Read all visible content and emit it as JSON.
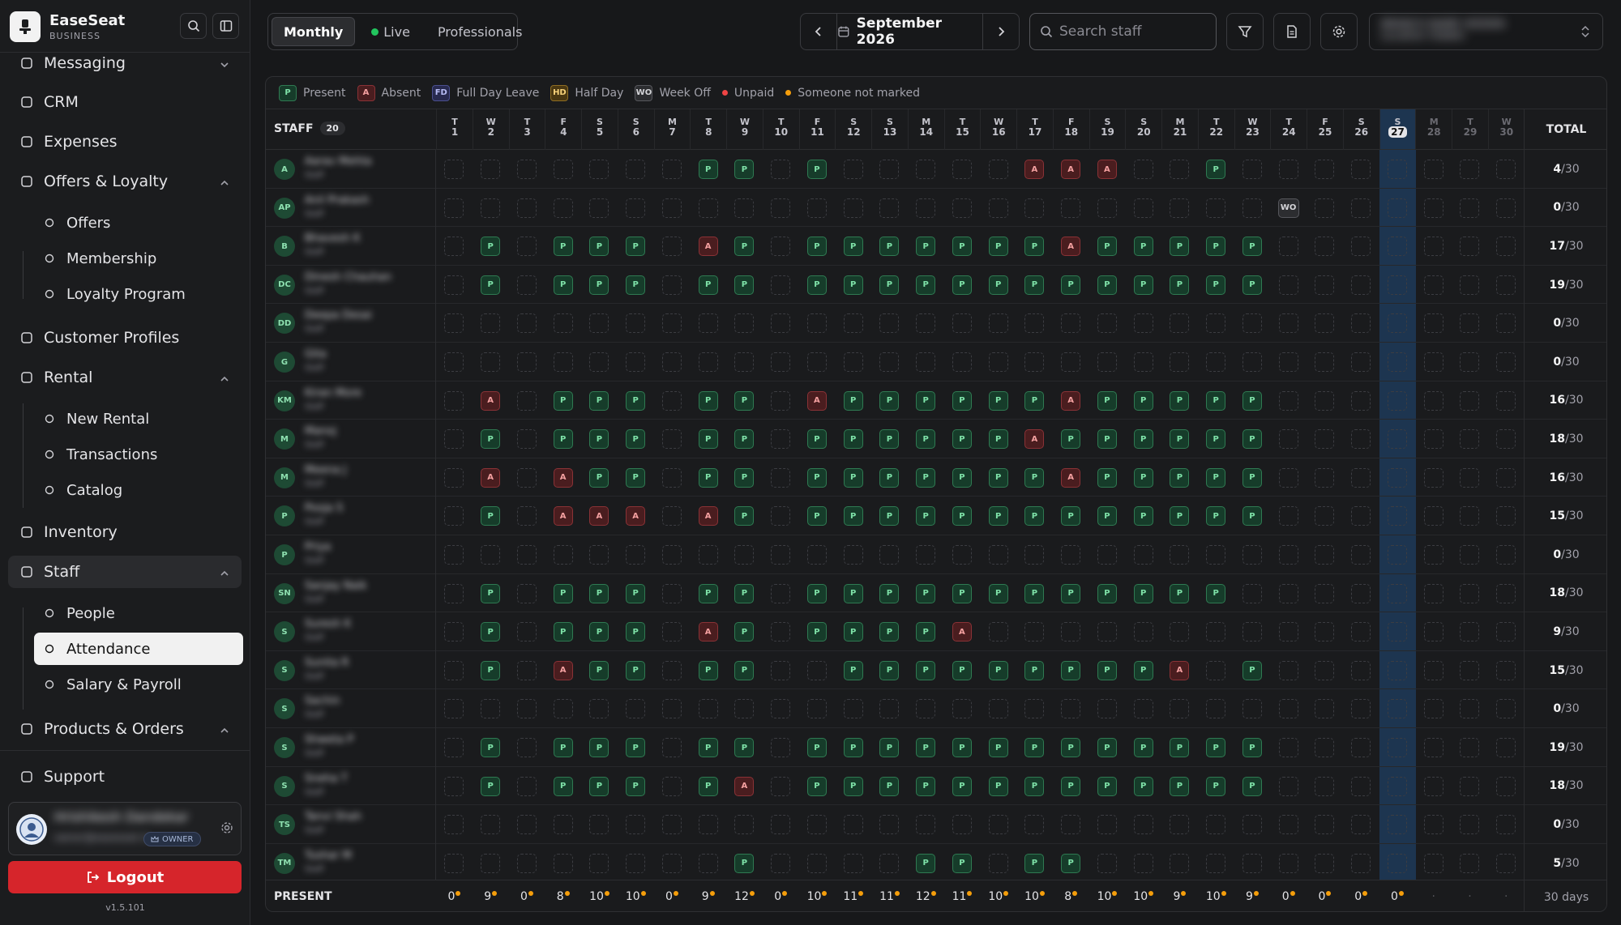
{
  "app": {
    "name": "EaseSeat",
    "edition": "BUSINESS",
    "version": "v1.5.101"
  },
  "sidebar": {
    "items": [
      {
        "label": "Messaging",
        "icon": "message-icon",
        "chevron": "down"
      },
      {
        "label": "CRM",
        "icon": "target-icon"
      },
      {
        "label": "Expenses",
        "icon": "wallet-icon"
      },
      {
        "label": "Offers & Loyalty",
        "icon": "badge-check-icon",
        "chevron": "up"
      },
      {
        "label": "Offers",
        "icon": "gift-icon",
        "sub": true
      },
      {
        "label": "Membership",
        "icon": "list-icon",
        "sub": true
      },
      {
        "label": "Loyalty Program",
        "icon": "award-icon",
        "sub": true
      },
      {
        "label": "Customer Profiles",
        "icon": "users-icon"
      },
      {
        "label": "Rental",
        "icon": "package-icon",
        "chevron": "up"
      },
      {
        "label": "New Rental",
        "icon": "plus-icon",
        "sub": true
      },
      {
        "label": "Transactions",
        "icon": "history-icon",
        "sub": true
      },
      {
        "label": "Catalog",
        "icon": "list-icon",
        "sub": true
      },
      {
        "label": "Inventory",
        "icon": "warehouse-icon"
      },
      {
        "label": "Staff",
        "icon": "user-cog-icon",
        "chevron": "up"
      },
      {
        "label": "People",
        "icon": "users-icon",
        "sub": true
      },
      {
        "label": "Attendance",
        "icon": "user-check-icon",
        "sub": true
      },
      {
        "label": "Salary & Payroll",
        "icon": "banknote-icon",
        "sub": true
      },
      {
        "label": "Products & Orders",
        "icon": "package-icon",
        "chevron": "up"
      },
      {
        "label": "Support",
        "icon": "message-circle-icon"
      }
    ],
    "user": {
      "name": "Hrishikesh Dandekar",
      "email": "owner@easeseat.in",
      "role": "OWNER"
    },
    "logout_label": "Logout"
  },
  "header": {
    "tabs": [
      "Monthly",
      "Live",
      "Professionals"
    ],
    "active_tab": "Monthly",
    "month": "September 2026",
    "search_placeholder": "Search staff",
    "branch": {
      "name": "BRANCH NAME HIDDEN",
      "sub": "Location hidden"
    }
  },
  "legend": [
    {
      "code": "P",
      "label": "Present"
    },
    {
      "code": "A",
      "label": "Absent"
    },
    {
      "code": "FD",
      "label": "Full Day Leave"
    },
    {
      "code": "HD",
      "label": "Half Day"
    },
    {
      "code": "WO",
      "label": "Week Off"
    },
    {
      "code": "",
      "label": "Unpaid",
      "dot": "#ef4444"
    },
    {
      "code": "",
      "label": "Someone not marked",
      "dot": "#f59e0b"
    }
  ],
  "grid": {
    "staff_header": "STAFF",
    "staff_count": "20",
    "total_header": "TOTAL",
    "today": 27,
    "days": [
      {
        "w": "T",
        "d": 1
      },
      {
        "w": "W",
        "d": 2
      },
      {
        "w": "T",
        "d": 3
      },
      {
        "w": "F",
        "d": 4
      },
      {
        "w": "S",
        "d": 5
      },
      {
        "w": "S",
        "d": 6
      },
      {
        "w": "M",
        "d": 7
      },
      {
        "w": "T",
        "d": 8
      },
      {
        "w": "W",
        "d": 9
      },
      {
        "w": "T",
        "d": 10
      },
      {
        "w": "F",
        "d": 11
      },
      {
        "w": "S",
        "d": 12
      },
      {
        "w": "S",
        "d": 13
      },
      {
        "w": "M",
        "d": 14
      },
      {
        "w": "T",
        "d": 15
      },
      {
        "w": "W",
        "d": 16
      },
      {
        "w": "T",
        "d": 17
      },
      {
        "w": "F",
        "d": 18
      },
      {
        "w": "S",
        "d": 19
      },
      {
        "w": "S",
        "d": 20
      },
      {
        "w": "M",
        "d": 21
      },
      {
        "w": "T",
        "d": 22
      },
      {
        "w": "W",
        "d": 23
      },
      {
        "w": "T",
        "d": 24
      },
      {
        "w": "F",
        "d": 25
      },
      {
        "w": "S",
        "d": 26
      },
      {
        "w": "S",
        "d": 27
      },
      {
        "w": "M",
        "d": 28
      },
      {
        "w": "T",
        "d": 29
      },
      {
        "w": "W",
        "d": 30
      }
    ],
    "staff": [
      {
        "initials": "A",
        "name": "Aarav Mehta",
        "role": "Staff",
        "total": "4",
        "marks": {
          "8": "P",
          "9": "P",
          "11": "P",
          "17": "A",
          "18": "A",
          "19": "A",
          "22": "P"
        }
      },
      {
        "initials": "AP",
        "name": "Anil Prakash",
        "role": "Staff",
        "total": "0",
        "marks": {
          "24": "WO"
        }
      },
      {
        "initials": "B",
        "name": "Bhavesh K",
        "role": "Staff",
        "total": "17",
        "marks": {
          "2": "P",
          "4": "P",
          "5": "P",
          "6": "P",
          "8": "A",
          "9": "P",
          "11": "P",
          "12": "P",
          "13": "P",
          "14": "P",
          "15": "P",
          "16": "P",
          "17": "P",
          "18": "A",
          "19": "P",
          "20": "P",
          "21": "P",
          "22": "P",
          "23": "P"
        }
      },
      {
        "initials": "DC",
        "name": "Dinesh Chauhan",
        "role": "Staff",
        "total": "19",
        "marks": {
          "2": "P",
          "4": "P",
          "5": "P",
          "6": "P",
          "8": "P",
          "9": "P",
          "11": "P",
          "12": "P",
          "13": "P",
          "14": "P",
          "15": "P",
          "16": "P",
          "17": "P",
          "18": "P",
          "19": "P",
          "20": "P",
          "21": "P",
          "22": "P",
          "23": "P"
        }
      },
      {
        "initials": "DD",
        "name": "Deepa Desai",
        "role": "Staff",
        "total": "0",
        "marks": {}
      },
      {
        "initials": "G",
        "name": "Gita",
        "role": "Staff",
        "total": "0",
        "marks": {}
      },
      {
        "initials": "KM",
        "name": "Kiran More",
        "role": "Staff",
        "total": "16",
        "marks": {
          "2": "A",
          "4": "P",
          "5": "P",
          "6": "P",
          "8": "P",
          "9": "P",
          "11": "A",
          "12": "P",
          "13": "P",
          "14": "P",
          "15": "P",
          "16": "P",
          "17": "P",
          "18": "A",
          "19": "P",
          "20": "P",
          "21": "P",
          "22": "P",
          "23": "P"
        }
      },
      {
        "initials": "M",
        "name": "Manoj",
        "role": "Staff",
        "total": "18",
        "marks": {
          "2": "P",
          "4": "P",
          "5": "P",
          "6": "P",
          "8": "P",
          "9": "P",
          "11": "P",
          "12": "P",
          "13": "P",
          "14": "P",
          "15": "P",
          "16": "P",
          "17": "A",
          "18": "P",
          "19": "P",
          "20": "P",
          "21": "P",
          "22": "P",
          "23": "P"
        }
      },
      {
        "initials": "M",
        "name": "Meena J",
        "role": "Staff",
        "total": "16",
        "marks": {
          "2": "A",
          "4": "A",
          "5": "P",
          "6": "P",
          "8": "P",
          "9": "P",
          "11": "P",
          "12": "P",
          "13": "P",
          "14": "P",
          "15": "P",
          "16": "P",
          "17": "P",
          "18": "A",
          "19": "P",
          "20": "P",
          "21": "P",
          "22": "P",
          "23": "P"
        }
      },
      {
        "initials": "P",
        "name": "Pooja S",
        "role": "Staff",
        "total": "15",
        "marks": {
          "2": "P",
          "4": "A",
          "5": "A",
          "6": "A",
          "8": "A",
          "9": "P",
          "11": "P",
          "12": "P",
          "13": "P",
          "14": "P",
          "15": "P",
          "16": "P",
          "17": "P",
          "18": "P",
          "19": "P",
          "20": "P",
          "21": "P",
          "22": "P",
          "23": "P"
        }
      },
      {
        "initials": "P",
        "name": "Priya",
        "role": "Staff",
        "total": "0",
        "marks": {}
      },
      {
        "initials": "SN",
        "name": "Sanjay Naik",
        "role": "Staff",
        "total": "18",
        "marks": {
          "2": "P",
          "4": "P",
          "5": "P",
          "6": "P",
          "8": "P",
          "9": "P",
          "11": "P",
          "12": "P",
          "13": "P",
          "14": "P",
          "15": "P",
          "16": "P",
          "17": "P",
          "18": "P",
          "19": "P",
          "20": "P",
          "21": "P",
          "22": "P"
        }
      },
      {
        "initials": "S",
        "name": "Suresh K",
        "role": "Staff",
        "total": "9",
        "marks": {
          "2": "P",
          "4": "P",
          "5": "P",
          "6": "P",
          "8": "A",
          "9": "P",
          "11": "P",
          "12": "P",
          "13": "P",
          "14": "P",
          "15": "A"
        }
      },
      {
        "initials": "S",
        "name": "Sunita R",
        "role": "Staff",
        "total": "15",
        "marks": {
          "2": "P",
          "4": "A",
          "5": "P",
          "6": "P",
          "8": "P",
          "9": "P",
          "12": "P",
          "13": "P",
          "14": "P",
          "15": "P",
          "16": "P",
          "17": "P",
          "18": "P",
          "19": "P",
          "20": "P",
          "21": "A",
          "23": "P"
        }
      },
      {
        "initials": "S",
        "name": "Sachin",
        "role": "Staff",
        "total": "0",
        "marks": {}
      },
      {
        "initials": "S",
        "name": "Shweta P",
        "role": "Staff",
        "total": "19",
        "marks": {
          "2": "P",
          "4": "P",
          "5": "P",
          "6": "P",
          "8": "P",
          "9": "P",
          "11": "P",
          "12": "P",
          "13": "P",
          "14": "P",
          "15": "P",
          "16": "P",
          "17": "P",
          "18": "P",
          "19": "P",
          "20": "P",
          "21": "P",
          "22": "P",
          "23": "P"
        }
      },
      {
        "initials": "S",
        "name": "Sneha T",
        "role": "Staff",
        "total": "18",
        "marks": {
          "2": "P",
          "4": "P",
          "5": "P",
          "6": "P",
          "8": "P",
          "9": "A",
          "11": "P",
          "12": "P",
          "13": "P",
          "14": "P",
          "15": "P",
          "16": "P",
          "17": "P",
          "18": "P",
          "19": "P",
          "20": "P",
          "21": "P",
          "22": "P",
          "23": "P"
        }
      },
      {
        "initials": "TS",
        "name": "Tanvi Shah",
        "role": "Staff",
        "total": "0",
        "marks": {}
      },
      {
        "initials": "TM",
        "name": "Tushar M",
        "role": "Staff",
        "total": "5",
        "marks": {
          "9": "P",
          "14": "P",
          "15": "P",
          "17": "P",
          "18": "P"
        }
      }
    ],
    "month_days": "30",
    "footer": {
      "label": "PRESENT",
      "counts": [
        "0",
        "9",
        "0",
        "8",
        "10",
        "10",
        "0",
        "9",
        "12",
        "0",
        "10",
        "11",
        "11",
        "12",
        "11",
        "10",
        "10",
        "8",
        "10",
        "10",
        "9",
        "10",
        "9",
        "0",
        "0",
        "0",
        "0",
        "",
        "",
        ""
      ],
      "total": "30 days"
    }
  },
  "colors": {
    "present": "#7ee2a8",
    "absent": "#f4a0a0",
    "today_col": "#1d3550",
    "logout": "#d6252b",
    "live_dot": "#22c55e"
  }
}
